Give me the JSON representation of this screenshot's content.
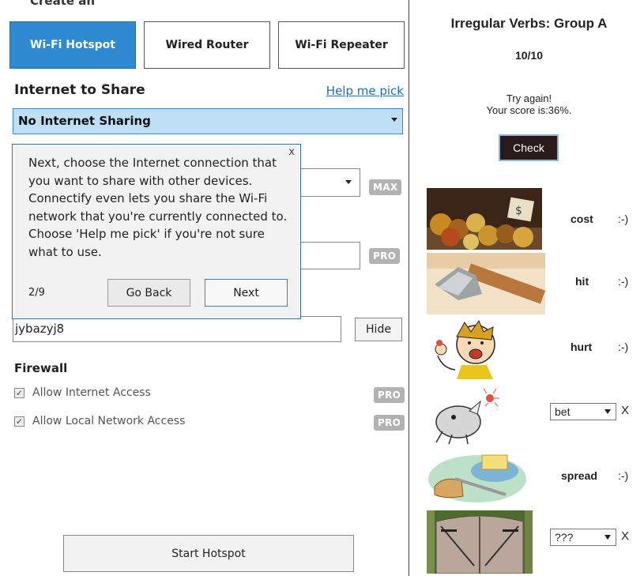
{
  "left": {
    "cut_title": "Create an",
    "modes": [
      {
        "label": "Wi-Fi Hotspot",
        "active": true
      },
      {
        "label": "Wired Router",
        "active": false
      },
      {
        "label": "Wi-Fi Repeater",
        "active": false
      }
    ],
    "internet_title": "Internet to Share",
    "help_link": "Help me pick",
    "internet_selected": "No Internet Sharing",
    "badge_max": "MAX",
    "badge_pro": "PRO",
    "password_value": "jybazyj8",
    "hide_label": "Hide",
    "firewall_title": "Firewall",
    "firewall_items": [
      {
        "label": "Allow Internet Access",
        "checked": true,
        "badge": "PRO"
      },
      {
        "label": "Allow Local Network Access",
        "checked": true,
        "badge": "PRO"
      }
    ],
    "start_label": "Start Hotspot",
    "tooltip": {
      "close": "x",
      "text": "Next, choose the Internet connection that you want to share with other devices.  Connectify even lets you share the Wi-Fi network that you're currently connected to. Choose 'Help me pick' if you're not sure what to use.",
      "step": "2/9",
      "back_label": "Go Back",
      "next_label": "Next"
    }
  },
  "quiz": {
    "title": "Irregular Verbs: Group A",
    "count": "10/10",
    "msg_line1": "Try again!",
    "msg_line2": "Your score is:36%.",
    "check_label": "Check",
    "items": [
      {
        "word": "cost",
        "status": ":-)"
      },
      {
        "word": "hit",
        "status": ":-)"
      },
      {
        "word": "hurt",
        "status": ":-)"
      },
      {
        "select_value": "bet",
        "status": "X"
      },
      {
        "word": "spread",
        "status": ":-)"
      },
      {
        "select_value": "???",
        "status": "X"
      }
    ]
  }
}
